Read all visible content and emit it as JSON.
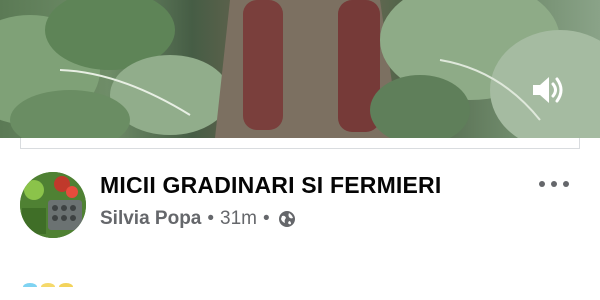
{
  "video": {
    "sound_icon": "volume-icon"
  },
  "post": {
    "title": "MICII GRADINARI SI FERMIERI",
    "author": "Silvia Popa",
    "separator": "•",
    "time": "31m",
    "audience_icon": "globe-icon",
    "more_icon": "more-options-icon"
  }
}
